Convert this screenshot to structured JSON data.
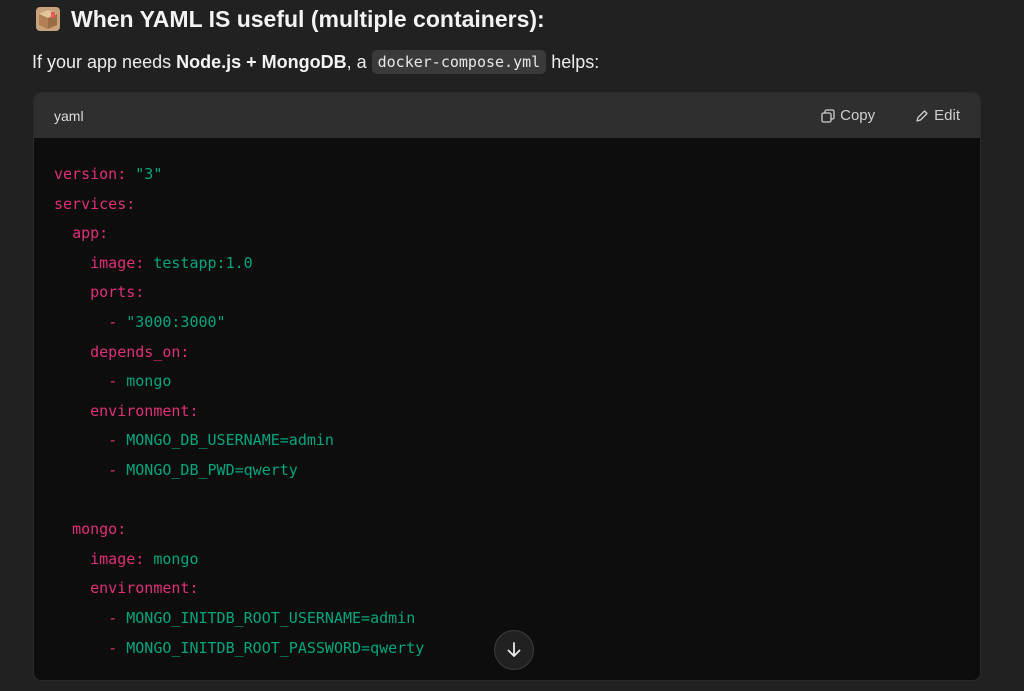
{
  "heading": {
    "icon": "package-box-icon",
    "text": "When YAML IS useful (multiple containers):"
  },
  "intro": {
    "prefix": "If your app needs ",
    "bold": "Node.js + MongoDB",
    "middle": ", a ",
    "code": "docker-compose.yml",
    "suffix": " helps:"
  },
  "code_block": {
    "language": "yaml",
    "copy_label": "Copy",
    "edit_label": "Edit",
    "lines": [
      {
        "indent": "",
        "key": "version:",
        "value": " \"3\""
      },
      {
        "indent": "",
        "key": "services:",
        "value": ""
      },
      {
        "indent": "  ",
        "key": "app:",
        "value": ""
      },
      {
        "indent": "    ",
        "key": "image:",
        "value": " testapp:1.0"
      },
      {
        "indent": "    ",
        "key": "ports:",
        "value": ""
      },
      {
        "indent": "      ",
        "key": "- ",
        "value": "\"3000:3000\""
      },
      {
        "indent": "    ",
        "key": "depends_on:",
        "value": ""
      },
      {
        "indent": "      ",
        "key": "- ",
        "value": "mongo"
      },
      {
        "indent": "    ",
        "key": "environment:",
        "value": ""
      },
      {
        "indent": "      ",
        "key": "- ",
        "value": "MONGO_DB_USERNAME=admin"
      },
      {
        "indent": "      ",
        "key": "- ",
        "value": "MONGO_DB_PWD=qwerty"
      },
      {
        "indent": "",
        "key": "",
        "value": ""
      },
      {
        "indent": "  ",
        "key": "mongo:",
        "value": ""
      },
      {
        "indent": "    ",
        "key": "image:",
        "value": " mongo"
      },
      {
        "indent": "    ",
        "key": "environment:",
        "value": ""
      },
      {
        "indent": "      ",
        "key": "- ",
        "value": "MONGO_INITDB_ROOT_USERNAME=admin"
      },
      {
        "indent": "      ",
        "key": "- ",
        "value": "MONGO_INITDB_ROOT_PASSWORD=qwerty"
      }
    ]
  },
  "scroll_button": {
    "icon": "arrow-down-icon"
  },
  "colors": {
    "background": "#212121",
    "code_background": "#0d0d0d",
    "code_header": "#2f2f2f",
    "yaml_key": "#df3079",
    "yaml_value": "#00a67d"
  }
}
